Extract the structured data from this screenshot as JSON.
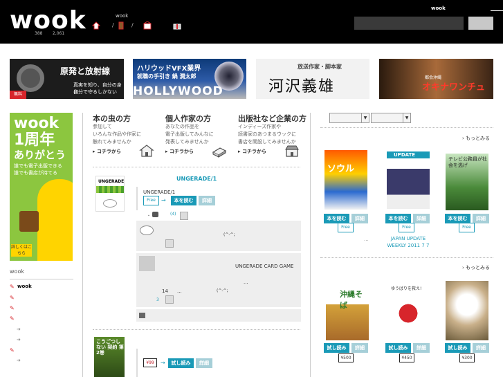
{
  "header": {
    "logo": "wook",
    "stat_a": "388",
    "stat_b": "2,061",
    "site_name": "wook",
    "user_label": "wook",
    "sep1": "/",
    "sep2": "/"
  },
  "banners": [
    {
      "title": "原発と放射線",
      "line1": "真実を知り、自分の身は",
      "line2": "自分で守るしかない",
      "badge": "無料"
    },
    {
      "title": "ハリウッドVFX業界",
      "subtitle": "就職の手引き 鍋 潤太郎",
      "brand": "HOLLYWOOD"
    },
    {
      "subtitle": "放送作家・脚本家",
      "title": "河沢義雄"
    },
    {
      "subtitle": "都会沖縄",
      "title": "オキナワンチュ"
    }
  ],
  "promo": {
    "line1": "wook",
    "line2": "1周年",
    "line3": "ありがとう",
    "line4": "誰でも電子出版できる",
    "line5": "誰でも書店が持てる",
    "badge": "詳しくはこちら"
  },
  "sidebar": {
    "title": "wook",
    "item_label": "wook"
  },
  "categories": [
    {
      "title": "本の虫の方",
      "desc1": "参加して",
      "desc2": "いろんな作品や作家に",
      "desc3": "触れてみませんか",
      "link": "コチラから"
    },
    {
      "title": "個人作家の方",
      "desc1": "あなたの作品を",
      "desc2": "電子出版してみんなに",
      "desc3": "発表してみませんか",
      "link": "コチラから"
    },
    {
      "title": "出版社など企業の方",
      "desc1": "インディーズ作家や",
      "desc2": "読書家のあつまるウックに",
      "desc3": "書店を開設してみませんか",
      "link": "コチラから"
    }
  ],
  "feed": {
    "title": "UNGERADE/1",
    "thumb_label": "UNGERADE",
    "item_title": "UNGERADE/1",
    "free_label": "Free",
    "arrow": "→",
    "read_button": "本を読む",
    "detail_button": "詳細",
    "meta_dot": "・",
    "likes": "(4)",
    "emot1": "(^-^;",
    "card_title": "UNGERADE CARD GAME",
    "card_dots": "...",
    "card_comment_count": "14",
    "card_dots_inline": "...",
    "card_emot": "(^-^;",
    "card_likes": "3",
    "book2_title": "こうごつしない 契約 第2巻",
    "price": "¥99",
    "trial_button": "試し読み",
    "detail_button2": "詳細"
  },
  "right": {
    "more1": "もっとみる",
    "more2": "もっとみる",
    "arrow": "›",
    "row1": [
      {
        "cover_title": "ソウル",
        "read": "本を読む",
        "detail": "詳細",
        "free": "Free",
        "caption": "..."
      },
      {
        "cover_title": "UPDATE",
        "read": "本を読む",
        "detail": "詳細",
        "free": "Free",
        "caption_a": "JAPAN UPDATE",
        "caption_b": "WEEKLY 2011 7 7"
      },
      {
        "cover_title": "テレビ公務員が社会を逃げ",
        "read": "本を読む",
        "detail": "詳細",
        "free": "Free"
      }
    ],
    "row2": [
      {
        "cover_title": "沖縄そば",
        "trial": "試し読み",
        "detail": "詳細",
        "price": "¥500"
      },
      {
        "cover_title": "ゆうばりを救え!",
        "trial": "試し読み",
        "detail": "詳細",
        "price": "¥450"
      },
      {
        "cover_title": "",
        "trial": "試し読み",
        "detail": "詳細",
        "price": "¥300"
      }
    ]
  }
}
